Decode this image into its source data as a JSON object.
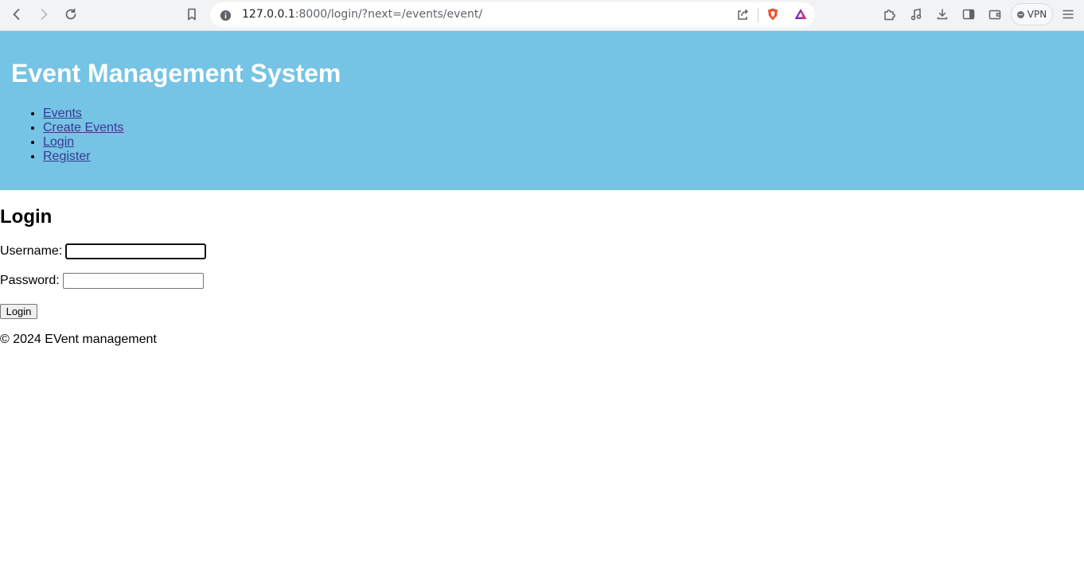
{
  "browser": {
    "url_host": "127.0.0.1",
    "url_rest": ":8000/login/?next=/events/event/",
    "vpn_label": "VPN",
    "icons": [
      "back-icon",
      "forward-icon",
      "reload-icon",
      "bookmark-icon",
      "site-info-icon",
      "share-icon",
      "brave-shield-icon",
      "brave-rewards-icon",
      "extensions-icon",
      "media-icon",
      "download-icon",
      "sidebar-icon",
      "wallet-icon",
      "menu-icon"
    ]
  },
  "header": {
    "title": "Event Management System",
    "nav": [
      "Events",
      "Create Events",
      "Login",
      "Register"
    ],
    "background": "#75c4e5",
    "link_color": "#3a3790"
  },
  "main": {
    "heading": "Login",
    "username_label": "Username:",
    "username_value": "",
    "password_label": "Password:",
    "password_value": "",
    "login_button": "Login"
  },
  "footer": {
    "text": "© 2024 EVent management"
  }
}
